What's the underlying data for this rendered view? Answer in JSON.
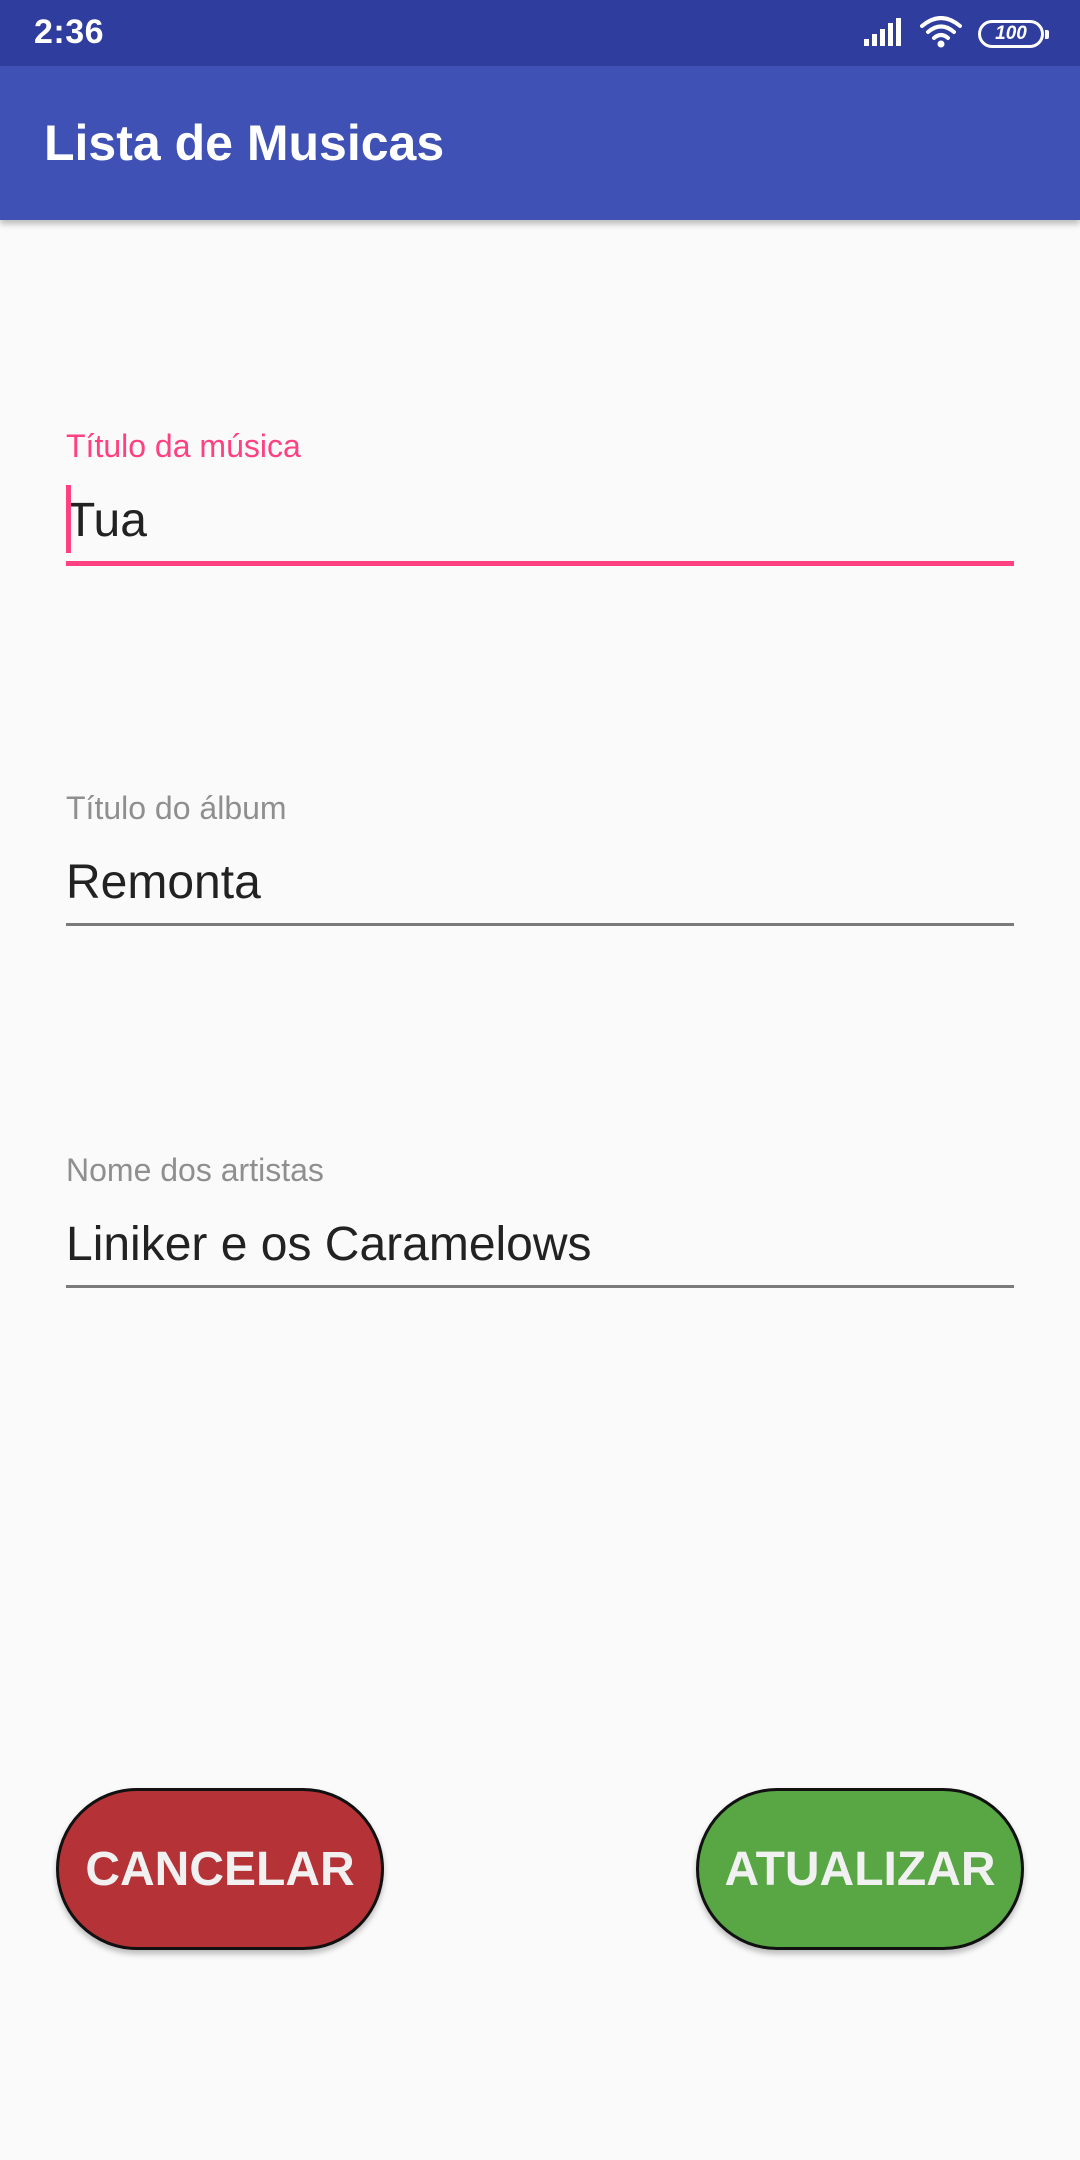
{
  "status_bar": {
    "time": "2:36",
    "battery": "100",
    "icons": [
      "signal-icon",
      "wifi-icon",
      "battery-icon"
    ]
  },
  "app_bar": {
    "title": "Lista de Musicas",
    "color": "#3f51b5"
  },
  "form": {
    "song_title": {
      "label": "Título da música",
      "value": "Tua",
      "focused": true
    },
    "album_title": {
      "label": "Título do álbum",
      "value": "Remonta"
    },
    "artists_name": {
      "label": "Nome dos artistas",
      "value": "Liniker e os Caramelows"
    }
  },
  "actions": {
    "cancel_label": "CANCELAR",
    "update_label": "ATUALIZAR"
  },
  "colors": {
    "accent": "#ff4081",
    "cancel": "#b53337",
    "update": "#59a644",
    "status_bar": "#2f3d9e"
  }
}
